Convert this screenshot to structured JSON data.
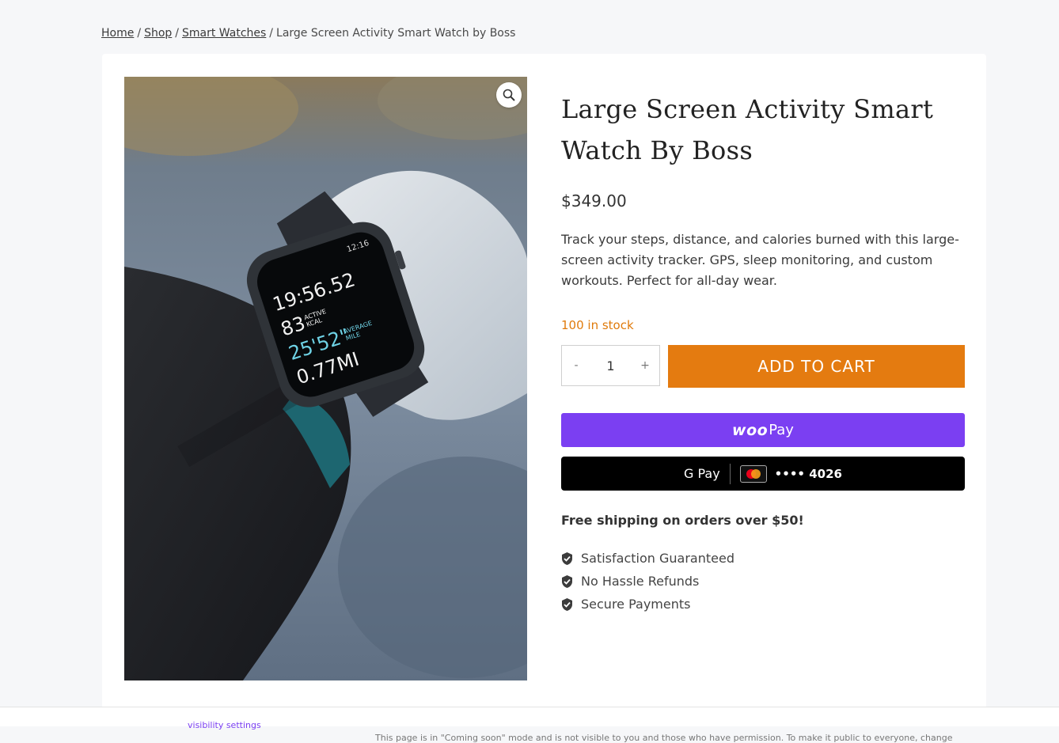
{
  "breadcrumb": {
    "items": [
      "Home",
      "Shop",
      "Smart Watches"
    ],
    "separator": "/",
    "current": "Large Screen Activity Smart Watch by Boss"
  },
  "product": {
    "title": "Large Screen Activity Smart Watch By Boss",
    "price": "$349.00",
    "description": "Track your steps, distance, and calories burned with this large-screen activity tracker. GPS, sleep monitoring, and custom workouts. Perfect for all-day wear.",
    "stock": "100 in stock",
    "quantity": "1",
    "qty_minus": "-",
    "qty_plus": "+",
    "add_to_cart": "ADD TO CART",
    "watch_screen": {
      "time": "12:16",
      "duration": "19:56.52",
      "kcal_value": "83",
      "kcal_label_1": "ACTIVE",
      "kcal_label_2": "KCAL",
      "pace": "25'52\"",
      "pace_label_1": "AVERAGE",
      "pace_label_2": "MILE",
      "distance": "0.77MI"
    }
  },
  "payments": {
    "woopay_brand_1": "woo",
    "woopay_brand_2": "Pay",
    "gpay_brand": "G Pay",
    "card_digits": "•••• 4026"
  },
  "shipping_notice": "Free shipping on orders over $50!",
  "benefits": [
    "Satisfaction Guaranteed",
    "No Hassle Refunds",
    "Secure Payments"
  ],
  "footer": {
    "text": "This page is in \"Coming soon\" mode and is not visible to you and those who have permission. To make it public to everyone, change ",
    "link": "visibility settings"
  },
  "colors": {
    "accent": "#e47b10",
    "stock": "#e07b0c",
    "woopay": "#7b3ff2",
    "gpay": "#000000"
  },
  "icons": [
    "zoom-icon",
    "check-shield-icon",
    "mastercard-icon",
    "google-g-icon"
  ]
}
